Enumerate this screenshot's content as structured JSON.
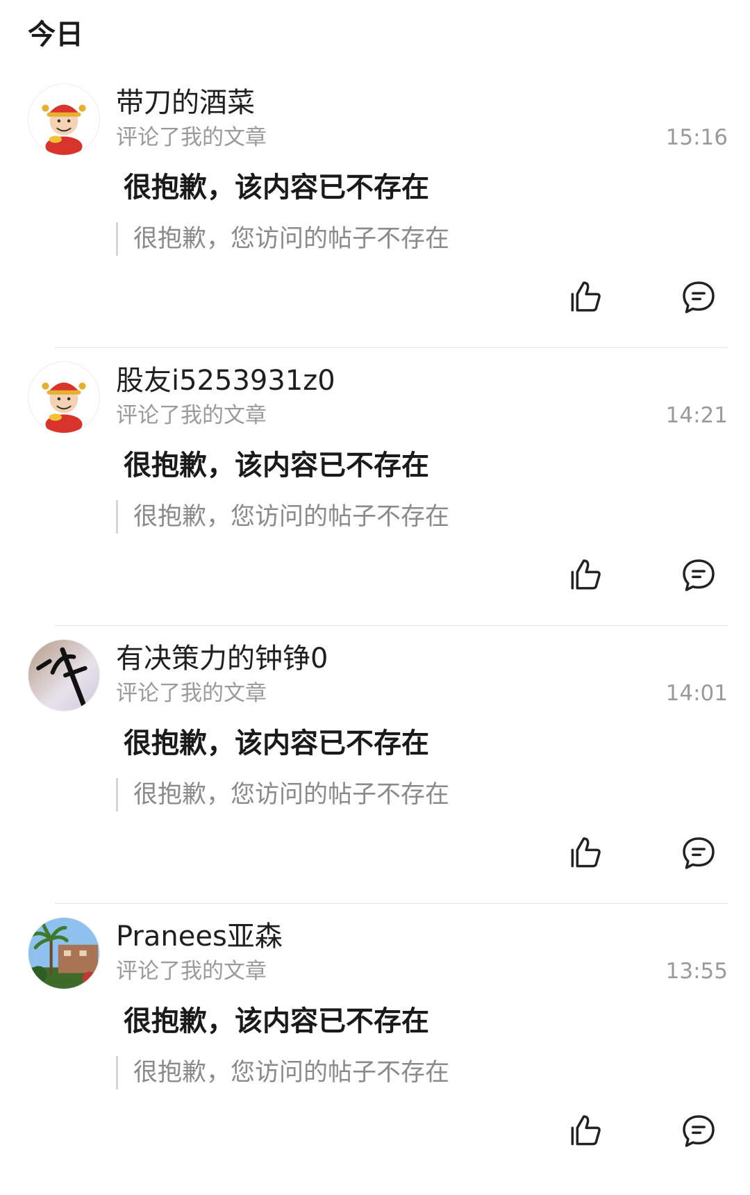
{
  "section": {
    "title": "今日"
  },
  "notifications": [
    {
      "username": "带刀的酒菜",
      "action": "评论了我的文章",
      "time": "15:16",
      "comment": "很抱歉，该内容已不存在",
      "quote": "很抱歉，您访问的帖子不存在",
      "avatar": "caishen-cartoon"
    },
    {
      "username": "股友i5253931z0",
      "action": "评论了我的文章",
      "time": "14:21",
      "comment": "很抱歉，该内容已不存在",
      "quote": "很抱歉，您访问的帖子不存在",
      "avatar": "caishen-cartoon"
    },
    {
      "username": "有决策力的钟铮0",
      "action": "评论了我的文章",
      "time": "14:01",
      "comment": "很抱歉，该内容已不存在",
      "quote": "很抱歉，您访问的帖子不存在",
      "avatar": "handwriting-photo"
    },
    {
      "username": "Pranees亚森",
      "action": "评论了我的文章",
      "time": "13:55",
      "comment": "很抱歉，该内容已不存在",
      "quote": "很抱歉，您访问的帖子不存在",
      "avatar": "palm-house-photo"
    }
  ],
  "icons": {
    "like": "thumbs-up-icon",
    "reply": "comment-bubble-icon"
  },
  "colors": {
    "primary_text": "#1a1a1a",
    "secondary_text": "#9a9a9a",
    "quote_text": "#8a8a8a",
    "divider": "#e8e8e8"
  }
}
